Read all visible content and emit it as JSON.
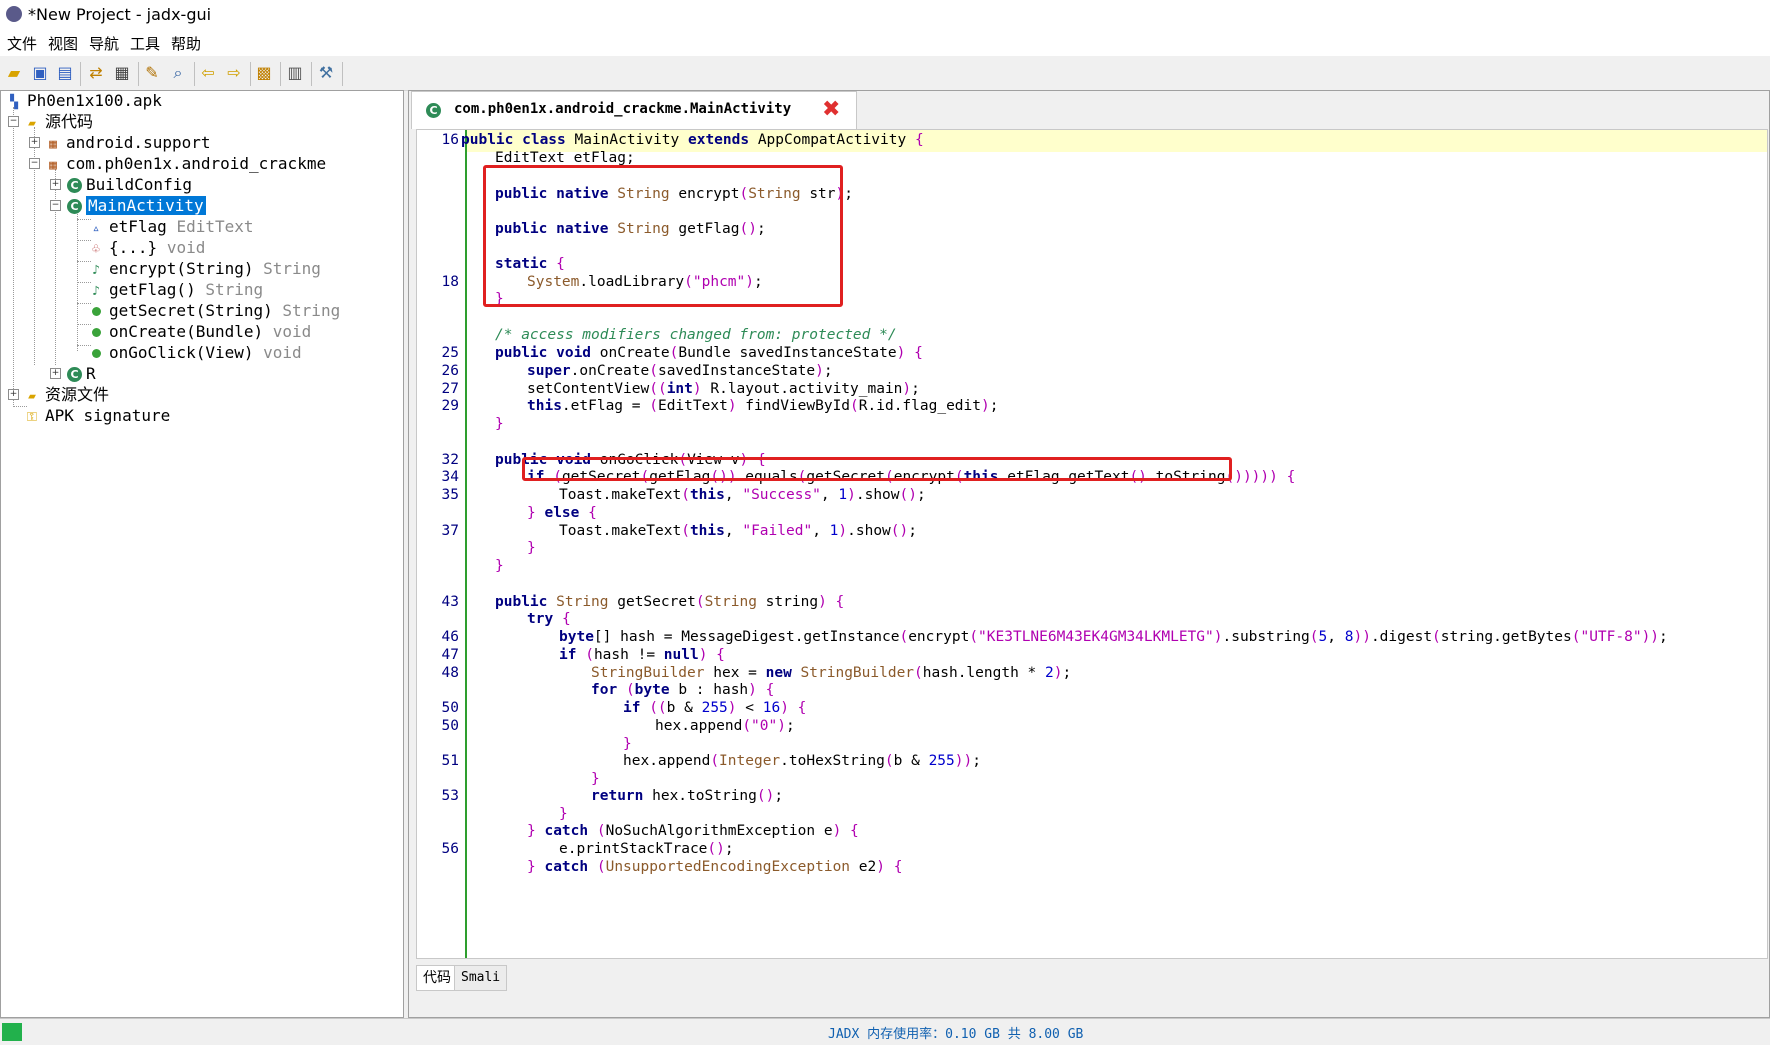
{
  "window": {
    "title": "*New Project - jadx-gui"
  },
  "menu": [
    "文件",
    "视图",
    "导航",
    "工具",
    "帮助"
  ],
  "toolbar_icons": [
    "open-icon",
    "save-icon",
    "save-all-icon",
    "sync-icon",
    "flatten-icon",
    "decompile-icon",
    "search-icon",
    "back-icon",
    "forward-icon",
    "deobf-icon",
    "log-icon",
    "prefs-icon"
  ],
  "tree": {
    "root": "Ph0en1x100.apk",
    "source": "源代码",
    "pkg1": "android.support",
    "pkg2": "com.ph0en1x.android_crackme",
    "buildconfig": "BuildConfig",
    "mainactivity": "MainActivity",
    "members": [
      {
        "name": "etFlag",
        "type": "EditText"
      },
      {
        "name": "{...}",
        "type": "void"
      },
      {
        "name": "encrypt(String)",
        "type": "String"
      },
      {
        "name": "getFlag()",
        "type": "String"
      },
      {
        "name": "getSecret(String)",
        "type": "String"
      },
      {
        "name": "onCreate(Bundle)",
        "type": "void"
      },
      {
        "name": "onGoClick(View)",
        "type": "void"
      }
    ],
    "r": "R",
    "resources": "资源文件",
    "signature": "APK signature"
  },
  "editor_tab": {
    "title": "com.ph0en1x.android_crackme.MainActivity"
  },
  "line_numbers": [
    "16",
    "18",
    "25",
    "26",
    "27",
    "29",
    "32",
    "34",
    "35",
    "37",
    "43",
    "46",
    "47",
    "48",
    "50",
    "50",
    "51",
    "53",
    "56"
  ],
  "bottom_tabs": [
    "代码",
    "Smali"
  ],
  "status": {
    "memory": "JADX 内存使用率：0.10 GB 共 8.00 GB"
  },
  "colors": {
    "selection": "#0078d7",
    "highlight": "#ffffcc",
    "gutter": "#2e9e2e",
    "annotation_box": "#e02020",
    "status_ok": "#22b14c"
  }
}
